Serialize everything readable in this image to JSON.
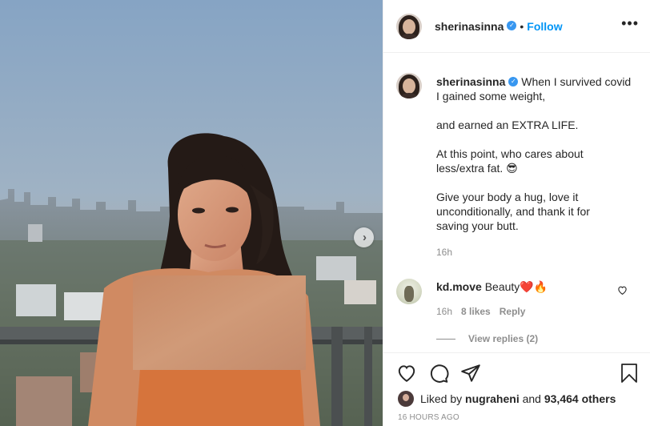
{
  "post": {
    "username": "sherinasinna",
    "verified_mark": "✓",
    "follow_label": "Follow",
    "separator": "•",
    "more_label": "•••",
    "carousel_next": "›"
  },
  "caption": {
    "username": "sherinasinna",
    "lines": [
      "When I survived covid",
      "I gained some weight,",
      "and earned an EXTRA LIFE.",
      "At this point, who cares about",
      "less/extra fat. 😎",
      "Give your body a hug, love it",
      "unconditionally, and thank it for",
      "saving your butt."
    ],
    "time": "16h"
  },
  "comment": {
    "username": "kd.move",
    "text": "Beauty",
    "emojis": "❤️🔥",
    "time": "16h",
    "likes": "8 likes",
    "reply_label": "Reply",
    "view_replies": "View replies (2)"
  },
  "icons": {
    "like": "heart-icon",
    "comment": "comment-icon",
    "share": "share-icon",
    "save": "bookmark-icon",
    "comment_like": "heart-icon"
  },
  "likes": {
    "prefix": "Liked by",
    "user": "nugraheni",
    "middle": "and",
    "count": "93,464 others"
  },
  "timestamp": "16 HOURS AGO",
  "colors": {
    "link": "#0095f6",
    "verified": "#3897f0",
    "muted": "#8e8e8e",
    "text": "#262626",
    "border": "#efefef"
  }
}
